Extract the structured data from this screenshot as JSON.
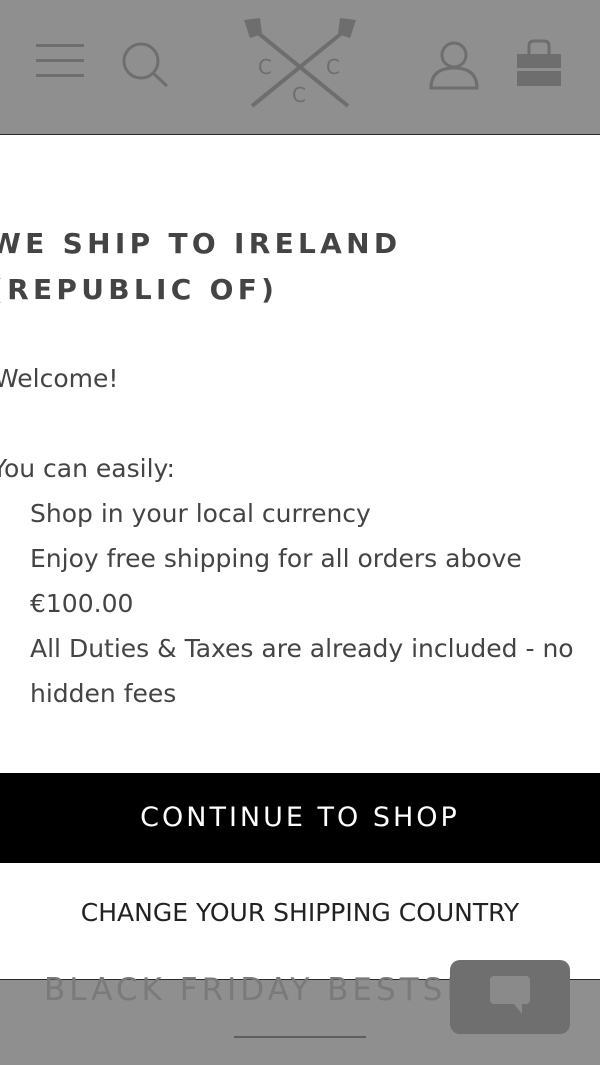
{
  "header": {
    "menu_icon": "hamburger-menu-icon",
    "search_icon": "search-icon",
    "logo_letters": [
      "C",
      "C",
      "C"
    ],
    "account_icon": "user-icon",
    "bag_icon": "shopping-bag-icon"
  },
  "modal": {
    "title": "WE SHIP TO IRELAND (REPUBLIC OF)",
    "welcome": "Welcome!",
    "intro": "You can easily:",
    "benefits": [
      "Shop in your local currency",
      "Enjoy free shipping for all orders above €100.00",
      "All Duties & Taxes are already included - no hidden fees"
    ],
    "continue_label": "CONTINUE TO SHOP",
    "change_country_label": "CHANGE YOUR SHIPPING COUNTRY"
  },
  "page": {
    "promo_banner": "BLACK FRIDAY BESTSE"
  },
  "chat": {
    "icon": "chat-bubble-icon"
  },
  "colors": {
    "overlay": "#8f8f8f",
    "modal_background": "#ffffff",
    "button_background": "#000000",
    "text": "#444444"
  }
}
